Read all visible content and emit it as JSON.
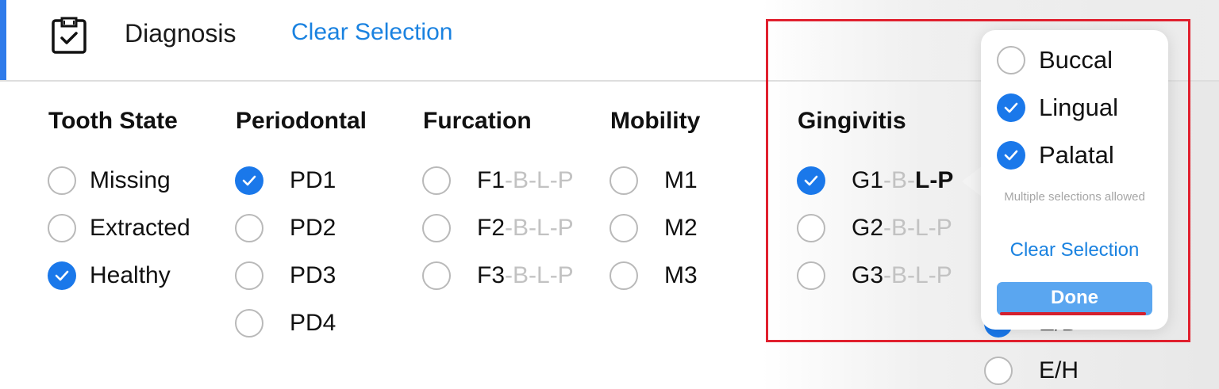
{
  "header": {
    "title": "Diagnosis",
    "clear_label": "Clear Selection",
    "icon": "clipboard-check-icon"
  },
  "columns": {
    "tooth_state": {
      "title": "Tooth State",
      "options": [
        {
          "label": "Missing",
          "checked": false
        },
        {
          "label": "Extracted",
          "checked": false
        },
        {
          "label": "Healthy",
          "checked": true
        }
      ]
    },
    "periodontal": {
      "title": "Periodontal",
      "options": [
        {
          "label": "PD1",
          "checked": true
        },
        {
          "label": "PD2",
          "checked": false
        },
        {
          "label": "PD3",
          "checked": false
        },
        {
          "label": "PD4",
          "checked": false
        }
      ]
    },
    "furcation": {
      "title": "Furcation",
      "options": [
        {
          "label": "F1",
          "suffix": "-B-L-P",
          "checked": false
        },
        {
          "label": "F2",
          "suffix": "-B-L-P",
          "checked": false
        },
        {
          "label": "F3",
          "suffix": "-B-L-P",
          "checked": false
        }
      ]
    },
    "mobility": {
      "title": "Mobility",
      "options": [
        {
          "label": "M1",
          "checked": false
        },
        {
          "label": "M2",
          "checked": false
        },
        {
          "label": "M3",
          "checked": false
        }
      ]
    },
    "gingivitis": {
      "title": "Gingivitis",
      "options": [
        {
          "label": "G1",
          "suffix_grey": "-B-",
          "suffix_bold": "L-P",
          "checked": true
        },
        {
          "label": "G2",
          "suffix": "-B-L-P",
          "checked": false
        },
        {
          "label": "G3",
          "suffix": "-B-L-P",
          "checked": false
        }
      ]
    },
    "extra": {
      "options": [
        {
          "label": "E/D",
          "checked": true
        },
        {
          "label": "E/H",
          "checked": false
        }
      ]
    }
  },
  "popover": {
    "options": [
      {
        "label": "Buccal",
        "checked": false
      },
      {
        "label": "Lingual",
        "checked": true
      },
      {
        "label": "Palatal",
        "checked": true
      }
    ],
    "hint": "Multiple selections allowed",
    "clear_label": "Clear Selection",
    "done_label": "Done"
  },
  "colors": {
    "accent": "#1a78ea",
    "link": "#1a82e0",
    "highlight": "#e0202e"
  }
}
